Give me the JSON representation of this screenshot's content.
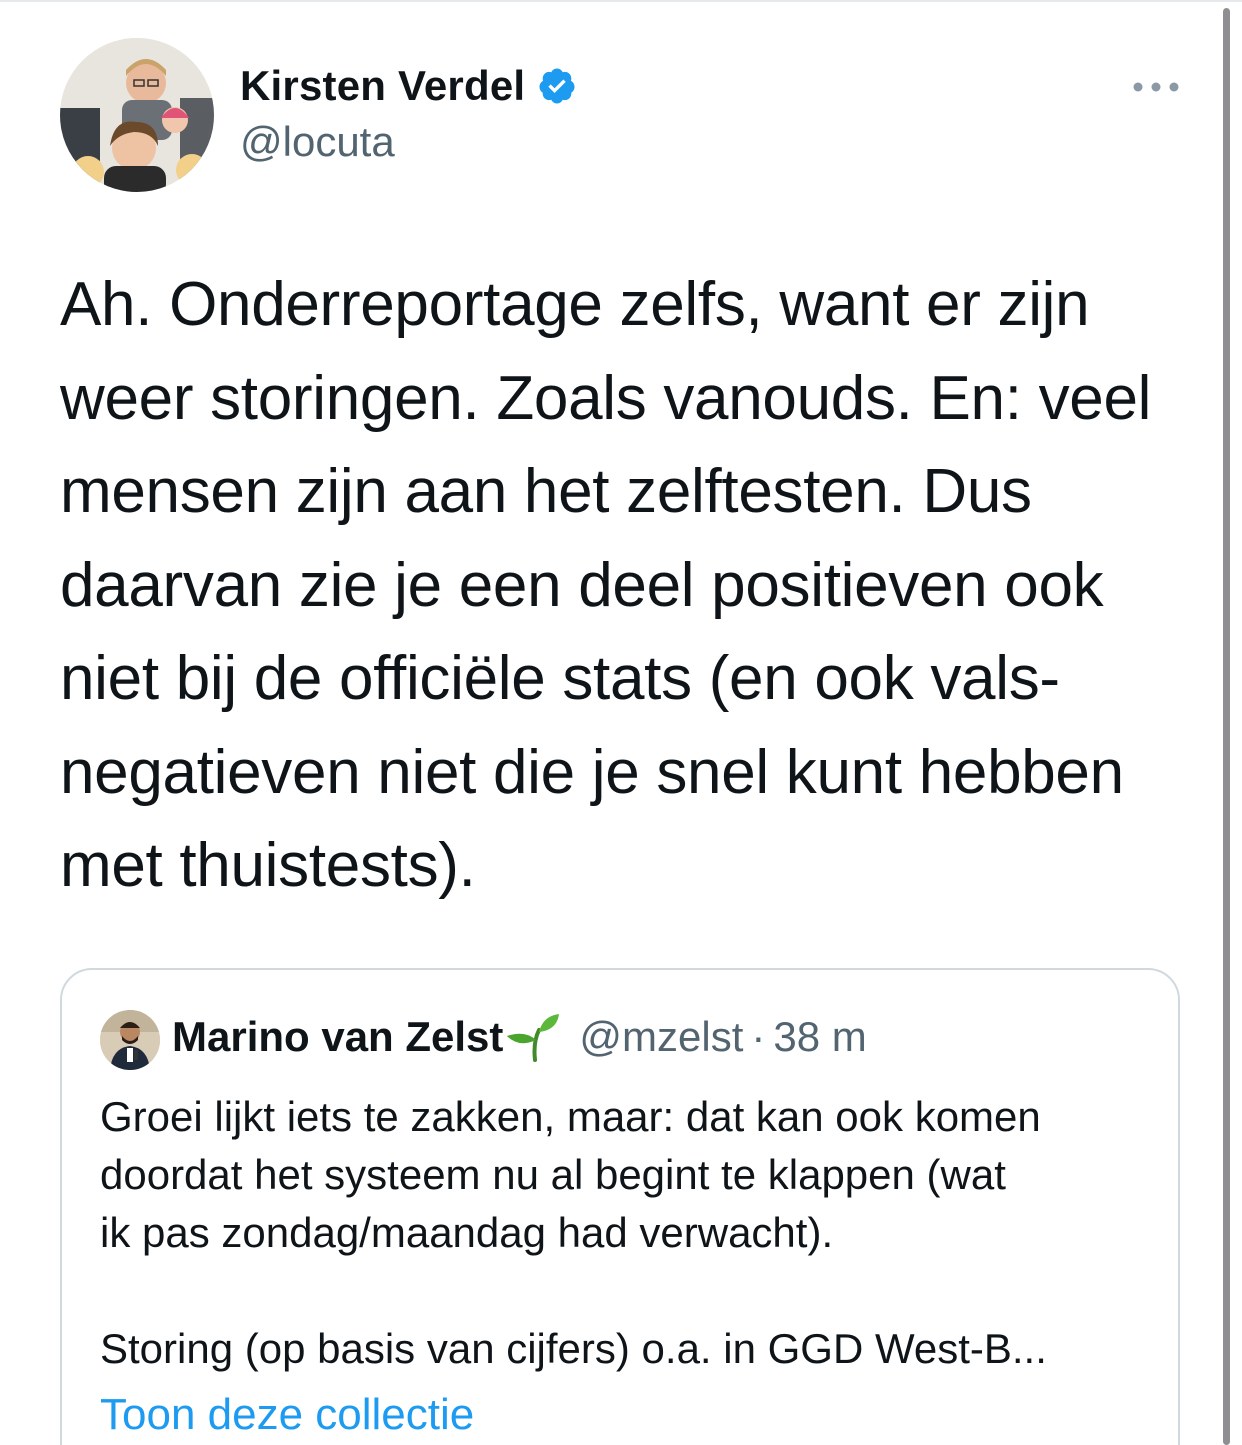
{
  "tweet": {
    "author": {
      "name": "Kirsten Verdel",
      "handle": "@locuta",
      "verified": true,
      "avatar_icon": "profile-photo"
    },
    "more_icon": "more-horizontal-icon",
    "text": "Ah. Onderreportage zelfs, want er zijn\nweer storingen. Zoals vanouds. En: veel\nmensen zijn aan het zelftesten. Dus\ndaarvan zie je een deel positieven ook\nniet bij de officiële stats (en ook vals-\nnegatieven niet die je snel kunt hebben\nmet thuistests)."
  },
  "quote": {
    "author": {
      "name": "Marino van Zelst",
      "name_emoji": "sprout-emoji",
      "handle": "@mzelst",
      "separator": "·",
      "time": "38 m"
    },
    "text": "Groei lijkt iets te zakken, maar: dat kan ook komen\ndoordat het systeem nu al begint te klappen (wat\nik pas zondag/maandag had verwacht).",
    "text_2": "Storing (op basis van cijfers) o.a. in GGD West-B...",
    "link_label": "Toon deze collectie"
  },
  "colors": {
    "text_primary": "#0f1419",
    "text_secondary": "#536471",
    "link": "#1d9bf0",
    "verified": "#1d9bf0",
    "border": "#cfd9de"
  }
}
